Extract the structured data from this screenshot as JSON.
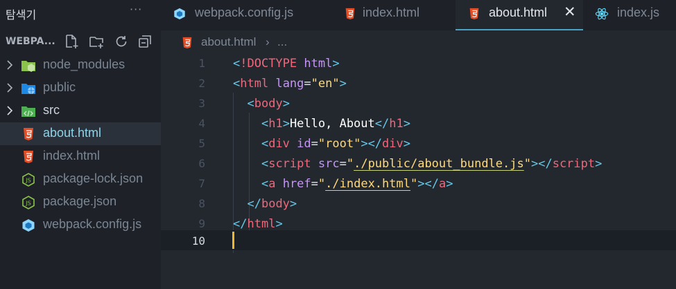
{
  "explorer": {
    "title": "탐색기",
    "more": "···",
    "section_label": "WEBPA...",
    "items": [
      {
        "label": "node_modules",
        "kind": "folder",
        "icon": "node-folder-icon",
        "expandable": true
      },
      {
        "label": "public",
        "kind": "folder",
        "icon": "globe-folder-icon",
        "expandable": true
      },
      {
        "label": "src",
        "kind": "folder",
        "icon": "code-folder-icon",
        "expandable": true
      },
      {
        "label": "about.html",
        "kind": "file",
        "icon": "html5-icon",
        "selected": true
      },
      {
        "label": "index.html",
        "kind": "file",
        "icon": "html5-icon"
      },
      {
        "label": "package-lock.json",
        "kind": "file",
        "icon": "nodejs-icon"
      },
      {
        "label": "package.json",
        "kind": "file",
        "icon": "nodejs-icon"
      },
      {
        "label": "webpack.config.js",
        "kind": "file",
        "icon": "webpack-icon"
      }
    ]
  },
  "tabs": [
    {
      "label": "webpack.config.js",
      "icon": "webpack-icon",
      "active": false
    },
    {
      "label": "index.html",
      "icon": "html5-icon",
      "active": false
    },
    {
      "label": "about.html",
      "icon": "html5-icon",
      "active": true,
      "close": "✕"
    },
    {
      "label": "index.js",
      "icon": "react-icon",
      "active": false
    }
  ],
  "breadcrumb": {
    "file": "about.html",
    "separator": "›",
    "rest": "..."
  },
  "editor": {
    "current_line": 10,
    "line_numbers": [
      "1",
      "2",
      "3",
      "4",
      "5",
      "6",
      "7",
      "8",
      "9",
      "10"
    ]
  },
  "colors": {
    "accent": "#4aa3c7",
    "html_icon": "#e44d26",
    "tag": "#f2667a",
    "attribute": "#c594f5",
    "string": "#ffd97a",
    "punctuation": "#67c8e8",
    "cursor": "#f0b52b"
  }
}
